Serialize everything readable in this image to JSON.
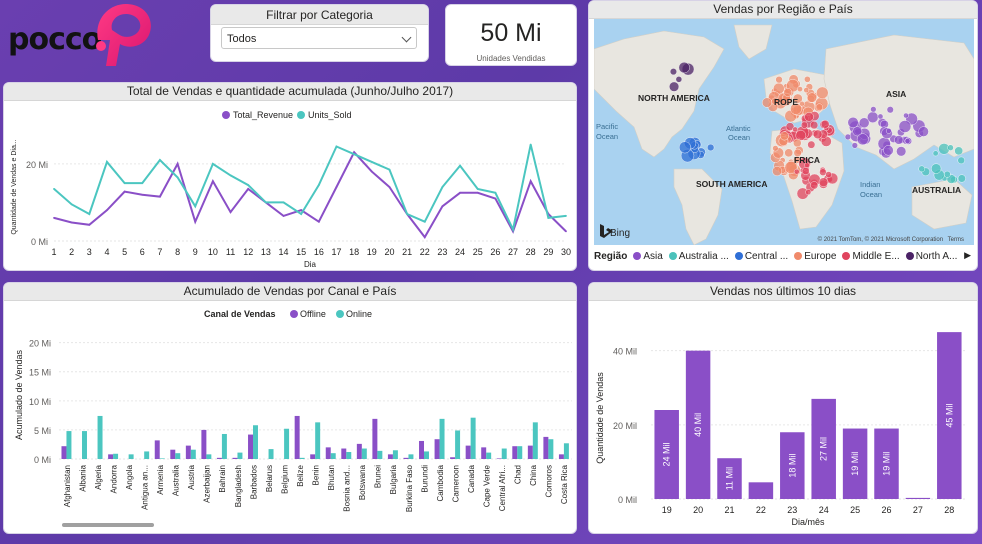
{
  "logo": {
    "text": "pocco"
  },
  "slicer": {
    "title": "Filtrar por Categoria",
    "value": "Todos"
  },
  "kpi": {
    "value": "50 Mi",
    "label": "Unidades Vendidas"
  },
  "map": {
    "title": "Vendas por Região e País",
    "labels": [
      {
        "text": "NORTH AMERICA",
        "kind": "continent"
      },
      {
        "text": "ROPE",
        "kind": "continent"
      },
      {
        "text": "ASIA",
        "kind": "continent"
      },
      {
        "text": "Atlantic",
        "kind": "ocean"
      },
      {
        "text": "Ocean",
        "kind": "ocean"
      },
      {
        "text": "Pacific",
        "kind": "ocean"
      },
      {
        "text": "Ocean",
        "kind": "ocean"
      },
      {
        "text": "FRICA",
        "kind": "continent"
      },
      {
        "text": "SOUTH AMERICA",
        "kind": "continent"
      },
      {
        "text": "Indian",
        "kind": "ocean"
      },
      {
        "text": "Ocean",
        "kind": "ocean"
      },
      {
        "text": "AUSTRALIA",
        "kind": "continent"
      }
    ],
    "bing": "Bing",
    "copyright": "© 2021 TomTom, © 2021 Microsoft Corporation",
    "terms": "Terms",
    "legend_title": "Região",
    "legend": [
      {
        "name": "Asia",
        "color": "#8a4fc7"
      },
      {
        "name": "Australia ...",
        "color": "#4bc2bb"
      },
      {
        "name": "Central ...",
        "color": "#2f6fd6"
      },
      {
        "name": "Europe",
        "color": "#f08a6a"
      },
      {
        "name": "Middle E...",
        "color": "#e0445e"
      },
      {
        "name": "North A...",
        "color": "#4b2266"
      }
    ],
    "legend_more": "▶"
  },
  "line_chart": {
    "title": "Total de Vendas e quantidade acumulada (Junho/Julho 2017)",
    "ylabel": "Quantidade de Vendas e Dia...",
    "xlabel": "Dia",
    "colors": {
      "Total_Revenue": "#8a4fc7",
      "Units_Sold": "#4bc6c0"
    }
  },
  "bar_chart": {
    "title": "Acumulado de Vendas por Canal e País",
    "legend_title": "Canal de Vendas",
    "ylabel": "Acumulado de Vendas",
    "colors": {
      "Offline": "#8a4fc7",
      "Online": "#4bc6c0"
    }
  },
  "last10": {
    "title": "Vendas nos últimos 10 dias",
    "ylabel": "Quantidade de Vendas",
    "xlabel": "Dia/mês",
    "color": "#8a4fc7"
  },
  "chart_data": [
    {
      "type": "line",
      "title": "Total de Vendas e quantidade acumulada (Junho/Julho 2017)",
      "xlabel": "Dia",
      "ylabel": "Quantidade de Vendas e Dia...",
      "x": [
        1,
        2,
        3,
        4,
        5,
        6,
        7,
        8,
        9,
        10,
        11,
        12,
        13,
        14,
        15,
        16,
        17,
        18,
        19,
        20,
        21,
        22,
        23,
        24,
        25,
        26,
        27,
        28,
        29,
        30
      ],
      "ylim": [
        0,
        28
      ],
      "yticks": [
        0,
        20
      ],
      "ytick_labels": [
        "0 Mi",
        "20 Mi"
      ],
      "legend": "top",
      "series": [
        {
          "name": "Total_Revenue",
          "values": [
            6,
            4.8,
            4.2,
            8,
            12.8,
            12,
            11.5,
            20,
            5,
            15.5,
            7.5,
            13.5,
            10,
            6.5,
            8,
            5,
            14,
            23,
            18,
            14,
            7,
            1,
            9,
            12.5,
            12.5,
            11,
            2.5,
            15.5,
            7,
            2.5
          ]
        },
        {
          "name": "Units_Sold",
          "values": [
            13.5,
            9.5,
            7,
            20.5,
            15,
            15,
            21,
            16.5,
            9,
            20,
            17,
            14.5,
            10,
            10,
            7,
            14.5,
            24.5,
            22.5,
            20.5,
            18.5,
            7,
            5,
            14,
            19.5,
            13.5,
            12.5,
            3,
            25,
            6,
            6.5
          ]
        }
      ]
    },
    {
      "type": "bar",
      "title": "Acumulado de Vendas por Canal e País",
      "ylabel": "Acumulado de Vendas",
      "ylim": [
        0,
        22
      ],
      "yticks": [
        0,
        5,
        10,
        15,
        20
      ],
      "ytick_labels": [
        "0 Mi",
        "5 Mi",
        "10 Mi",
        "15 Mi",
        "20 Mi"
      ],
      "categories": [
        "Afghanistan",
        "Albania",
        "Algeria",
        "Andorra",
        "Angola",
        "Antigua an...",
        "Armenia",
        "Australia",
        "Austria",
        "Azerbaijan",
        "Bahrain",
        "Bangladesh",
        "Barbados",
        "Belarus",
        "Belgium",
        "Belize",
        "Benin",
        "Bhutan",
        "Bosnia and...",
        "Botswana",
        "Brunei",
        "Bulgaria",
        "Burkina Faso",
        "Burundi",
        "Cambodia",
        "Cameroon",
        "Canada",
        "Cape Verde",
        "Central Afri...",
        "Chad",
        "China",
        "Comoros",
        "Costa Rica"
      ],
      "series": [
        {
          "name": "Offline",
          "values": [
            2.2,
            0,
            0,
            0.8,
            0,
            0,
            3.2,
            1.6,
            2.3,
            5,
            0.2,
            0.2,
            4.2,
            0,
            0,
            7.4,
            0.8,
            2,
            1.8,
            2.6,
            6.9,
            0.8,
            0.2,
            3.1,
            3.4,
            0.3,
            2.3,
            2,
            0.1,
            2.2,
            2.3,
            3.8,
            0.8
          ]
        },
        {
          "name": "Online",
          "values": [
            4.8,
            4.8,
            7.4,
            0.9,
            0.8,
            1.3,
            0.1,
            1.0,
            1.6,
            0.8,
            4.3,
            1.1,
            5.8,
            1.7,
            5.2,
            0.2,
            6.3,
            1.0,
            1.2,
            1.8,
            1.4,
            1.5,
            0.8,
            1.3,
            6.9,
            4.9,
            7.1,
            1.1,
            1.8,
            2.2,
            6.3,
            3.4,
            2.7
          ]
        }
      ]
    },
    {
      "type": "bar",
      "title": "Vendas nos últimos 10 dias",
      "xlabel": "Dia/mês",
      "ylabel": "Quantidade de Vendas",
      "categories": [
        "19",
        "20",
        "21",
        "22",
        "23",
        "24",
        "25",
        "26",
        "27",
        "28"
      ],
      "values": [
        24,
        40,
        11,
        4.5,
        18,
        27,
        19,
        19,
        0.3,
        45
      ],
      "data_labels": [
        "24 Mil",
        "40 Mil",
        "11 Mil",
        "",
        "18 Mil",
        "27 Mil",
        "19 Mil",
        "19 Mil",
        "",
        "45 Mil"
      ],
      "ylim": [
        0,
        48
      ],
      "yticks": [
        0,
        20,
        40
      ],
      "ytick_labels": [
        "0 Mil",
        "20 Mil",
        "40 Mil"
      ]
    }
  ]
}
